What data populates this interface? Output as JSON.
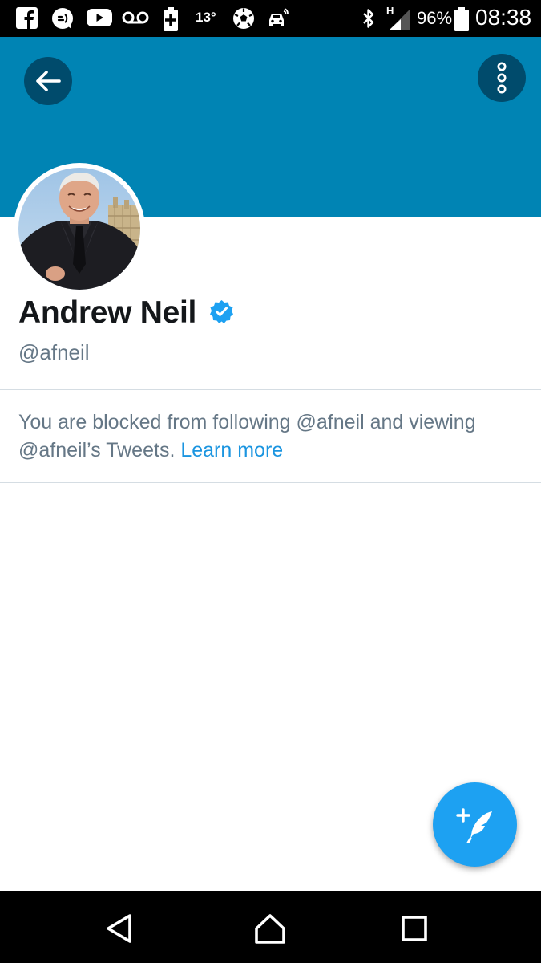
{
  "status_bar": {
    "temperature": "13°",
    "network": "H",
    "battery": "96%",
    "time": "08:38",
    "icons": [
      "facebook-icon",
      "messenger-icon",
      "youtube-icon",
      "voicemail-icon",
      "battery-saver-icon",
      "temperature-icon",
      "football-icon",
      "car-icon",
      "bluetooth-icon",
      "signal-icon",
      "battery-icon"
    ]
  },
  "header": {
    "background_color": "#0084b4",
    "back_icon": "arrow-left-icon",
    "more_icon": "vertical-dots-icon"
  },
  "profile": {
    "display_name": "Andrew Neil",
    "verified": true,
    "handle": "@afneil"
  },
  "blocked_notice": {
    "text": "You are blocked from following @afneil and viewing @afneil’s Tweets.",
    "link_label": "Learn more"
  },
  "fab": {
    "icon": "compose-tweet-icon",
    "color": "#1da1f2"
  },
  "nav_bar": {
    "buttons": [
      "back-icon",
      "home-icon",
      "recents-icon"
    ]
  }
}
